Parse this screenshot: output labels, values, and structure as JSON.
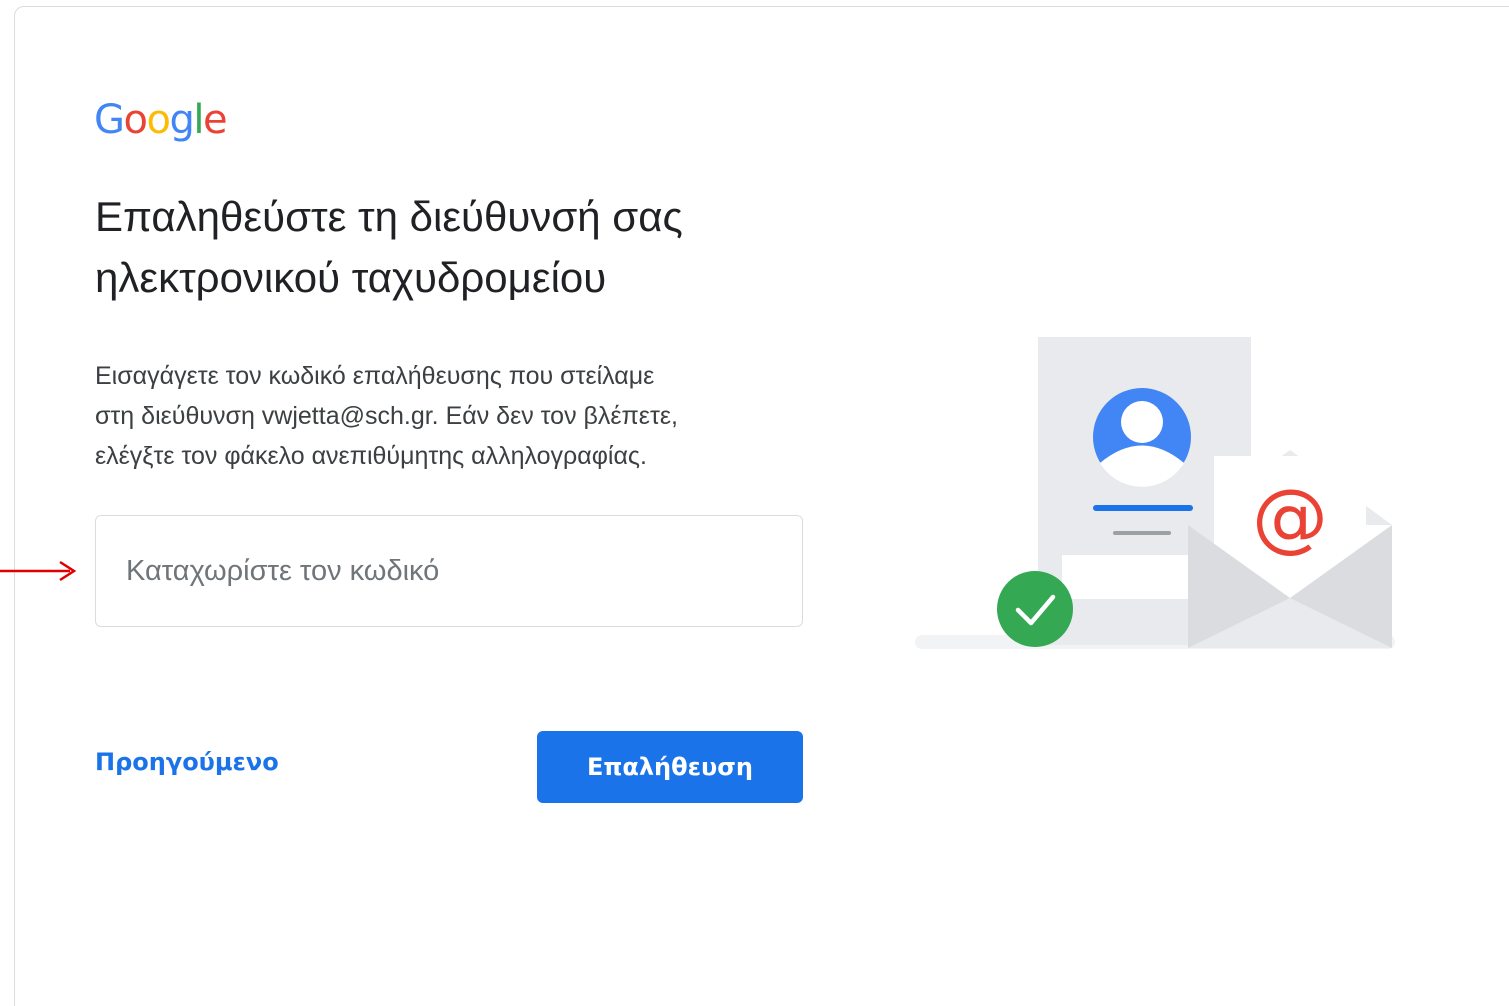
{
  "logo": {
    "letters": [
      "G",
      "o",
      "o",
      "g",
      "l",
      "e"
    ],
    "colors": [
      "#4285f4",
      "#ea4335",
      "#fbbc05",
      "#4285f4",
      "#34a853",
      "#ea4335"
    ]
  },
  "heading": {
    "line1": "Επαληθεύστε τη διεύθυνσή σας",
    "line2": "ηλεκτρονικού ταχυδρομείου"
  },
  "description": {
    "line1": "Εισαγάγετε τον κωδικό επαλήθευσης που στείλαμε",
    "line2": "στη διεύθυνση vwjetta@sch.gr. Εάν δεν τον βλέπετε,",
    "line3": "ελέγξτε τον φάκελο ανεπιθύμητης αλληλογραφίας."
  },
  "code_input": {
    "value": "",
    "placeholder": "Καταχωρίστε τον κωδικό"
  },
  "actions": {
    "back_label": "Προηγούμενο",
    "verify_label": "Επαλήθευση"
  },
  "illustration": {
    "at_symbol": "@",
    "icons": [
      "avatar-icon",
      "envelope-icon",
      "check-icon"
    ],
    "accent_blue": "#1a73e8",
    "accent_red": "#ea4335",
    "accent_green": "#34a853"
  },
  "annotation": {
    "arrow_color": "#e00000"
  }
}
